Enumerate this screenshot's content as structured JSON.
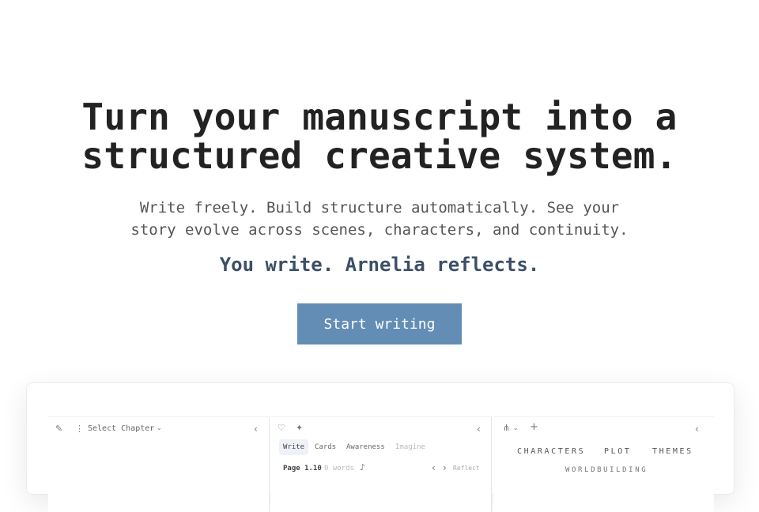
{
  "hero": {
    "headline_line1": "Turn your manuscript into a",
    "headline_line2": "structured creative system.",
    "subhead_line1": "Write freely. Build structure automatically. See your",
    "subhead_line2": "story evolve across scenes, characters, and continuity.",
    "tagline": "You write. Arnelia reflects.",
    "cta_label": "Start writing"
  },
  "colors": {
    "cta_background": "#638db5",
    "tagline": "#3c4f66",
    "headline": "#222222"
  },
  "preview": {
    "chapter_pane": {
      "feather_icon": "feather-icon",
      "more_icon": "more-vertical-icon",
      "chapter_select": "Select Chapter",
      "chevron_icon": "chevron-down-icon",
      "collapse_icon": "chevron-left-icon"
    },
    "editor_pane": {
      "heart_icon": "heart-icon",
      "sparkle_icon": "sparkle-icon",
      "collapse_icon": "chevron-left-icon",
      "tabs": [
        "Write",
        "Cards",
        "Awareness",
        "Imagine"
      ],
      "page_label": "Page 1.10",
      "word_count": "0 words",
      "mic_icon": "microphone-icon",
      "prev_icon": "chevron-left-icon",
      "next_icon": "chevron-right-icon",
      "reflect_label": "Reflect"
    },
    "story_pane": {
      "graph_icon": "network-icon",
      "add_icon": "plus-icon",
      "collapse_icon": "chevron-left-icon",
      "sections": [
        "CHARACTERS",
        "PLOT",
        "THEMES"
      ],
      "next_section": "WORLDBUILDING"
    }
  }
}
